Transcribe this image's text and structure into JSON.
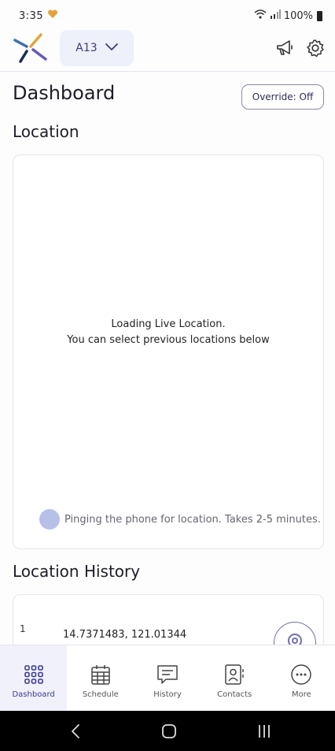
{
  "status_bar": {
    "time": "3:35",
    "battery": "100%"
  },
  "header": {
    "device_label": "A13"
  },
  "page_title": "Dashboard",
  "override_label": "Override: Off",
  "location": {
    "title": "Location",
    "loading_line1": "Loading Live Location.",
    "loading_line2": "You can select previous locations below",
    "ping_text": "Pinging the phone for location. Takes 2-5 minutes."
  },
  "history": {
    "title": "Location History",
    "items": [
      {
        "index": "1",
        "coords": "14.7371483, 121.01344"
      }
    ]
  },
  "nav": {
    "items": [
      {
        "label": "Dashboard",
        "icon": "grid-icon",
        "active": true
      },
      {
        "label": "Schedule",
        "icon": "calendar-icon"
      },
      {
        "label": "History",
        "icon": "chat-icon"
      },
      {
        "label": "Contacts",
        "icon": "contacts-icon"
      },
      {
        "label": "More",
        "icon": "more-icon"
      }
    ]
  },
  "colors": {
    "accent": "#3b3b96",
    "active_nav_bg": "#f0f1fa",
    "device_select_bg": "#eef0fa"
  }
}
